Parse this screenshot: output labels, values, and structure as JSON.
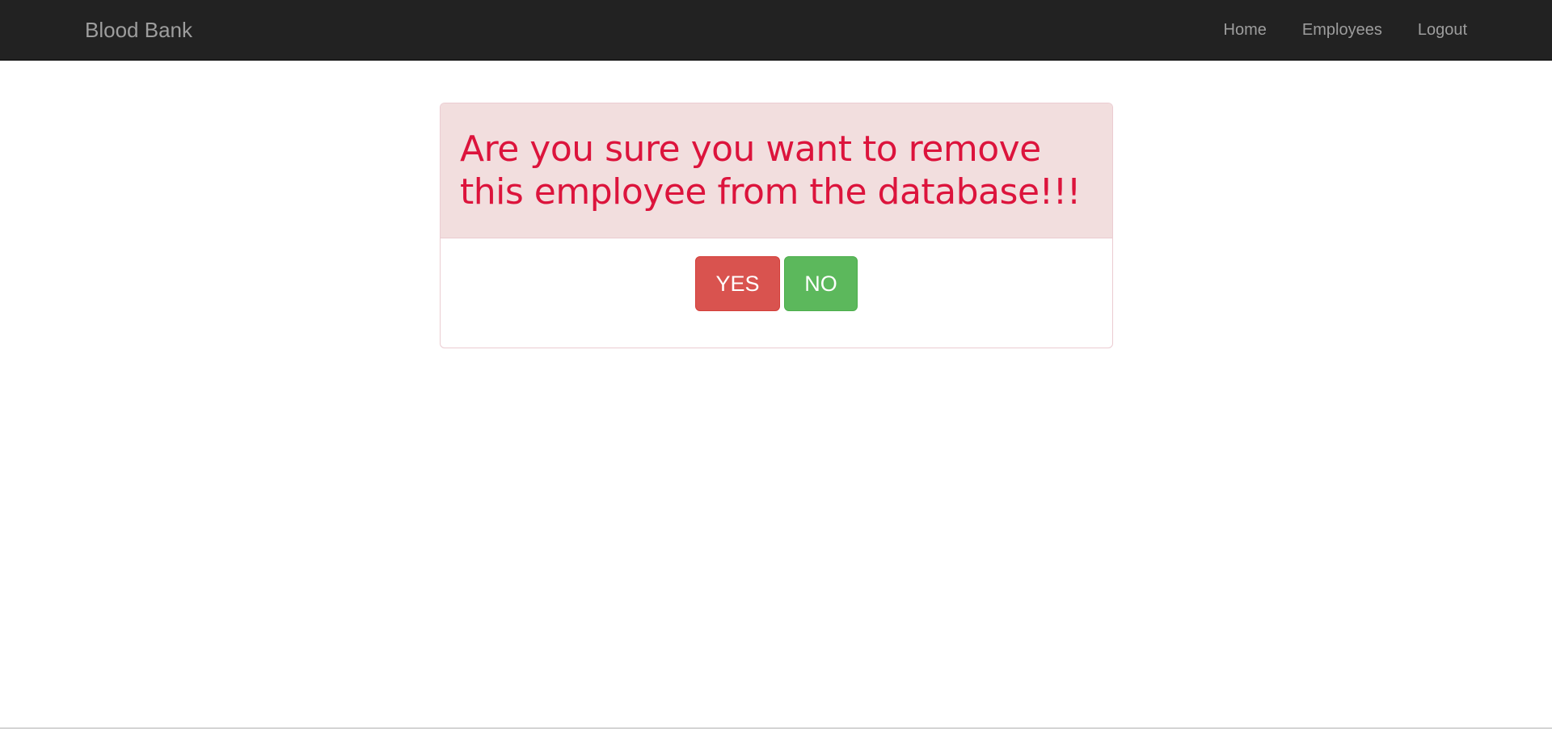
{
  "navbar": {
    "brand": "Blood Bank",
    "links": [
      {
        "label": "Home"
      },
      {
        "label": "Employees"
      },
      {
        "label": "Logout"
      }
    ]
  },
  "dialog": {
    "message_line1": "Are you sure you want to remove",
    "message_line2": "this employee from the database!!!",
    "yes_label": "YES",
    "no_label": "NO"
  },
  "colors": {
    "navbar_bg": "#222222",
    "nav_text": "#9d9d9d",
    "alert_bg": "#f2dede",
    "alert_text": "#dc143c",
    "yes_button": "#d9534f",
    "no_button": "#5cb85c"
  }
}
